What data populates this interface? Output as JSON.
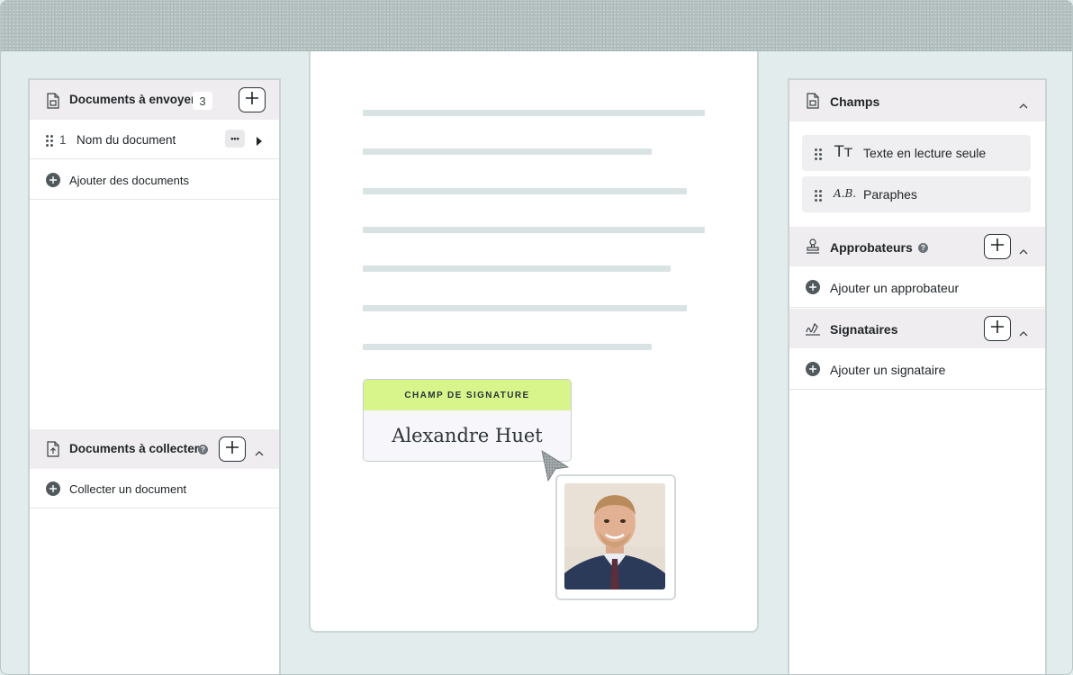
{
  "left_panel": {
    "send_section": {
      "title": "Documents à envoyer",
      "count": "3",
      "doc_row": {
        "index": "1",
        "name": "Nom du document",
        "more_label": "•••"
      },
      "add_label": "Ajouter des documents"
    },
    "collect_section": {
      "title": "Documents à collecter",
      "add_label": "Collecter un document"
    }
  },
  "document": {
    "signature_field": {
      "label": "CHAMP DE SIGNATURE",
      "signer_name": "Alexandre Huet"
    }
  },
  "right_panel": {
    "fields_section": {
      "title": "Champs",
      "items": [
        {
          "icon": "text-readonly-icon",
          "glyph": "Tт",
          "label": "Texte en lecture seule"
        },
        {
          "icon": "initials-icon",
          "glyph": "A.B.",
          "label": "Paraphes"
        }
      ]
    },
    "approvers_section": {
      "title": "Approbateurs",
      "add_label": "Ajouter un approbateur"
    },
    "signers_section": {
      "title": "Signataires",
      "add_label": "Ajouter un signataire"
    }
  },
  "colors": {
    "accent_green": "#d8f58c",
    "panel_header": "#efedef",
    "background": "#e2ecec"
  }
}
